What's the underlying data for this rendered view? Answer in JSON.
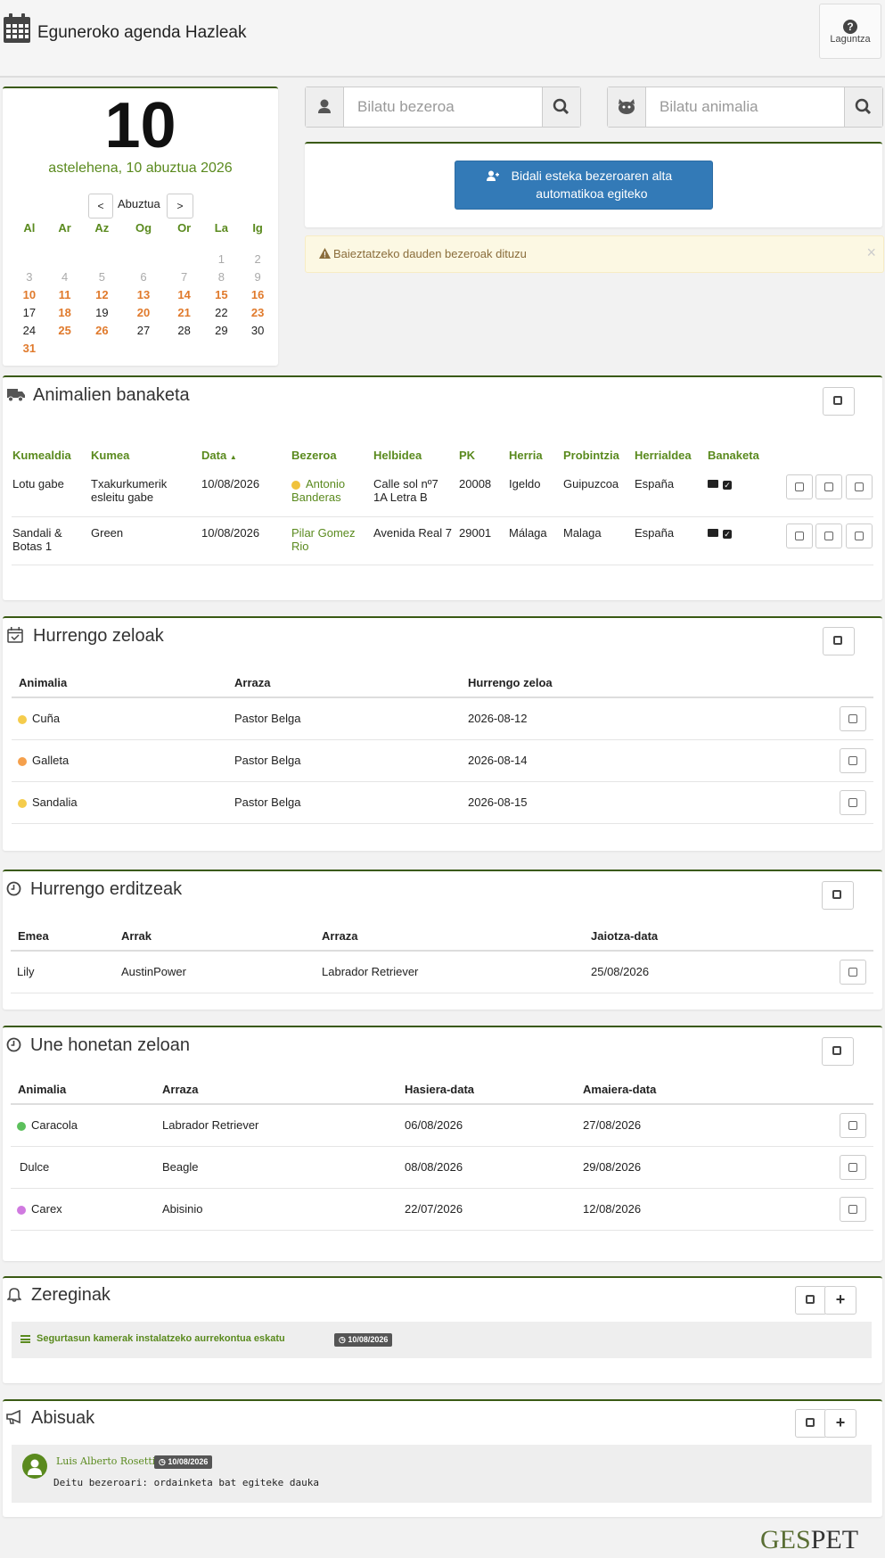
{
  "header": {
    "title": "Eguneroko agenda Hazleak",
    "help_label": "Laguntza"
  },
  "calendar": {
    "day_number": "10",
    "date_text": "astelehena, 10 abuztua 2026",
    "prev": "<",
    "next": ">",
    "month": "Abuztua",
    "weekdays": [
      "Al",
      "Ar",
      "Az",
      "Og",
      "Or",
      "La",
      "Ig"
    ],
    "weeks": [
      [
        {
          "d": "",
          "c": ""
        },
        {
          "d": "",
          "c": ""
        },
        {
          "d": "",
          "c": ""
        },
        {
          "d": "",
          "c": ""
        },
        {
          "d": "",
          "c": ""
        },
        {
          "d": "1",
          "c": "muted"
        },
        {
          "d": "2",
          "c": "muted"
        }
      ],
      [
        {
          "d": "3",
          "c": "muted"
        },
        {
          "d": "4",
          "c": "muted"
        },
        {
          "d": "5",
          "c": "muted"
        },
        {
          "d": "6",
          "c": "muted"
        },
        {
          "d": "7",
          "c": "muted"
        },
        {
          "d": "8",
          "c": "muted"
        },
        {
          "d": "9",
          "c": "muted"
        }
      ],
      [
        {
          "d": "10",
          "c": "orange"
        },
        {
          "d": "11",
          "c": "orange"
        },
        {
          "d": "12",
          "c": "orange"
        },
        {
          "d": "13",
          "c": "orange"
        },
        {
          "d": "14",
          "c": "orange"
        },
        {
          "d": "15",
          "c": "orange"
        },
        {
          "d": "16",
          "c": "orange"
        }
      ],
      [
        {
          "d": "17",
          "c": ""
        },
        {
          "d": "18",
          "c": "orange"
        },
        {
          "d": "19",
          "c": ""
        },
        {
          "d": "20",
          "c": "orange"
        },
        {
          "d": "21",
          "c": "orange"
        },
        {
          "d": "22",
          "c": ""
        },
        {
          "d": "23",
          "c": "orange"
        }
      ],
      [
        {
          "d": "24",
          "c": ""
        },
        {
          "d": "25",
          "c": "orange"
        },
        {
          "d": "26",
          "c": "orange"
        },
        {
          "d": "27",
          "c": ""
        },
        {
          "d": "28",
          "c": ""
        },
        {
          "d": "29",
          "c": ""
        },
        {
          "d": "30",
          "c": ""
        }
      ],
      [
        {
          "d": "31",
          "c": "orange"
        },
        {
          "d": "",
          "c": ""
        },
        {
          "d": "",
          "c": ""
        },
        {
          "d": "",
          "c": ""
        },
        {
          "d": "",
          "c": ""
        },
        {
          "d": "",
          "c": ""
        },
        {
          "d": "",
          "c": ""
        }
      ]
    ]
  },
  "search": {
    "client_placeholder": "Bilatu bezeroa",
    "animal_placeholder": "Bilatu animalia"
  },
  "send_link_button": "Bidali esteka bezeroaren alta automatikoa egiteko",
  "warning": {
    "text": "Baieztatzeko dauden bezeroak dituzu",
    "close": "×"
  },
  "deliveries": {
    "title": "Animalien banaketa",
    "columns": [
      "Kumealdia",
      "Kumea",
      "Data",
      "Bezeroa",
      "Helbidea",
      "PK",
      "Herria",
      "Probintzia",
      "Herrialdea",
      "Banaketa"
    ],
    "sort_indicator": "▲",
    "rows": [
      {
        "litter": "Lotu gabe",
        "puppy": "Txakurkumerik esleitu gabe",
        "date": "10/08/2026",
        "client": "Antonio Banderas",
        "client_dot": "#f0c23c",
        "address": "Calle sol nº7 1A Letra B",
        "pk": "20008",
        "town": "Igeldo",
        "province": "Guipuzcoa",
        "country": "España"
      },
      {
        "litter": "Sandali & Botas 1",
        "puppy": "Green",
        "date": "10/08/2026",
        "client": "Pilar Gomez Rio",
        "client_dot": "",
        "address": "Avenida Real 7",
        "pk": "29001",
        "town": "Málaga",
        "province": "Malaga",
        "country": "España"
      }
    ]
  },
  "next_heats": {
    "title": "Hurrengo zeloak",
    "columns": [
      "Animalia",
      "Arraza",
      "Hurrengo zeloa"
    ],
    "rows": [
      {
        "name": "Cuña",
        "dot": "#f5cc4c",
        "breed": "Pastor Belga",
        "date": "2026-08-12"
      },
      {
        "name": "Galleta",
        "dot": "#f5a04c",
        "breed": "Pastor Belga",
        "date": "2026-08-14"
      },
      {
        "name": "Sandalia",
        "dot": "#f5cc4c",
        "breed": "Pastor Belga",
        "date": "2026-08-15"
      }
    ]
  },
  "next_births": {
    "title": "Hurrengo erditzeak",
    "columns": [
      "Emea",
      "Arrak",
      "Arraza",
      "Jaiotza-data"
    ],
    "rows": [
      {
        "female": "Lily",
        "male": "AustinPower",
        "breed": "Labrador Retriever",
        "date": "25/08/2026"
      }
    ]
  },
  "in_heat": {
    "title": "Une honetan zeloan",
    "columns": [
      "Animalia",
      "Arraza",
      "Hasiera-data",
      "Amaiera-data"
    ],
    "rows": [
      {
        "name": "Caracola",
        "dot": "#5cc05c",
        "breed": "Labrador Retriever",
        "start": "06/08/2026",
        "end": "27/08/2026"
      },
      {
        "name": "Dulce",
        "dot": "",
        "breed": "Beagle",
        "start": "08/08/2026",
        "end": "29/08/2026"
      },
      {
        "name": "Carex",
        "dot": "#d07ae0",
        "breed": "Abisinio",
        "start": "22/07/2026",
        "end": "12/08/2026"
      }
    ]
  },
  "tasks": {
    "title": "Zereginak",
    "item_text": "Segurtasun kamerak instalatzeko aurrekontua eskatu",
    "item_date": "10/08/2026"
  },
  "notices": {
    "title": "Abisuak",
    "author": "Luis Alberto Rosetti",
    "date": "10/08/2026",
    "message": "Deitu bezeroari: ordainketa bat egiteke dauka"
  },
  "footer": {
    "brand_a": "GES",
    "brand_b": "PET"
  },
  "colors": {
    "accent_green": "#5a8a1e",
    "panel_border": "#3a5a14",
    "orange": "#e07a2c",
    "primary_blue": "#337ab7"
  }
}
